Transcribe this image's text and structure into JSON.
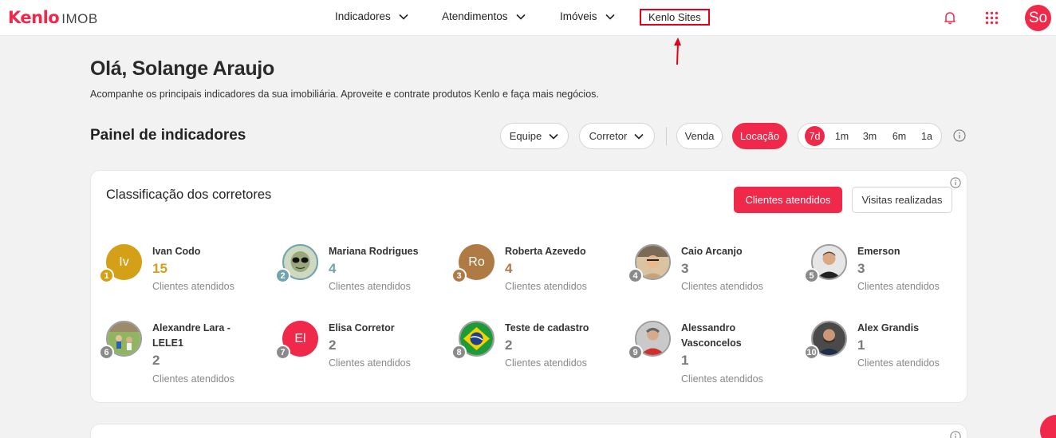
{
  "header": {
    "brand": "Kenlo",
    "product": "IMOB",
    "nav": [
      {
        "label": "Indicadores",
        "has_dropdown": true
      },
      {
        "label": "Atendimentos",
        "has_dropdown": true
      },
      {
        "label": "Imóveis",
        "has_dropdown": true
      },
      {
        "label": "Kenlo Sites",
        "has_dropdown": false
      }
    ],
    "icons": [
      "bell-icon",
      "apps-grid-icon"
    ],
    "avatar_initials": "So",
    "accent_color": "#f0284a"
  },
  "greeting": {
    "title": "Olá, Solange Araujo",
    "subtitle": "Acompanhe os principais indicadores da sua imobiliária. Aproveite e contrate produtos Kenlo e faça mais negócios."
  },
  "panel": {
    "title": "Painel de indicadores",
    "filters": {
      "team": "Equipe",
      "broker": "Corretor"
    },
    "modes": [
      {
        "label": "Venda",
        "active": false
      },
      {
        "label": "Locação",
        "active": true
      }
    ],
    "periods": [
      {
        "label": "7d",
        "active": true
      },
      {
        "label": "1m",
        "active": false
      },
      {
        "label": "3m",
        "active": false
      },
      {
        "label": "6m",
        "active": false
      },
      {
        "label": "1a",
        "active": false
      }
    ]
  },
  "ranking": {
    "title": "Classificação dos corretores",
    "tabs": {
      "primary": "Clientes atendidos",
      "secondary": "Visitas realizadas"
    },
    "metric_label": "Clientes atendidos",
    "brokers": [
      {
        "rank": "1",
        "name": "Ivan Codo",
        "count": "15",
        "initials": "Iv",
        "color": "#d4a017"
      },
      {
        "rank": "2",
        "name": "Mariana Rodrigues",
        "count": "4",
        "initials": "",
        "color": "#6fa3ad"
      },
      {
        "rank": "3",
        "name": "Roberta Azevedo",
        "count": "4",
        "initials": "Ro",
        "color": "#b07a45"
      },
      {
        "rank": "4",
        "name": "Caio Arcanjo",
        "count": "3",
        "initials": "",
        "color": "#8a8a8a"
      },
      {
        "rank": "5",
        "name": "Emerson",
        "count": "3",
        "initials": "",
        "color": "#8a8a8a"
      },
      {
        "rank": "6",
        "name": "Alexandre Lara - LELE1",
        "count": "2",
        "initials": "",
        "color": "#8a8a8a"
      },
      {
        "rank": "7",
        "name": "Elisa Corretor",
        "count": "2",
        "initials": "El",
        "color": "#f0284a"
      },
      {
        "rank": "8",
        "name": "Teste de cadastro",
        "count": "2",
        "initials": "",
        "color": "#8a8a8a"
      },
      {
        "rank": "9",
        "name": "Alessandro Vasconcelos",
        "count": "1",
        "initials": "",
        "color": "#8a8a8a"
      },
      {
        "rank": "10",
        "name": "Alex Grandis",
        "count": "1",
        "initials": "",
        "color": "#8a8a8a"
      }
    ]
  }
}
